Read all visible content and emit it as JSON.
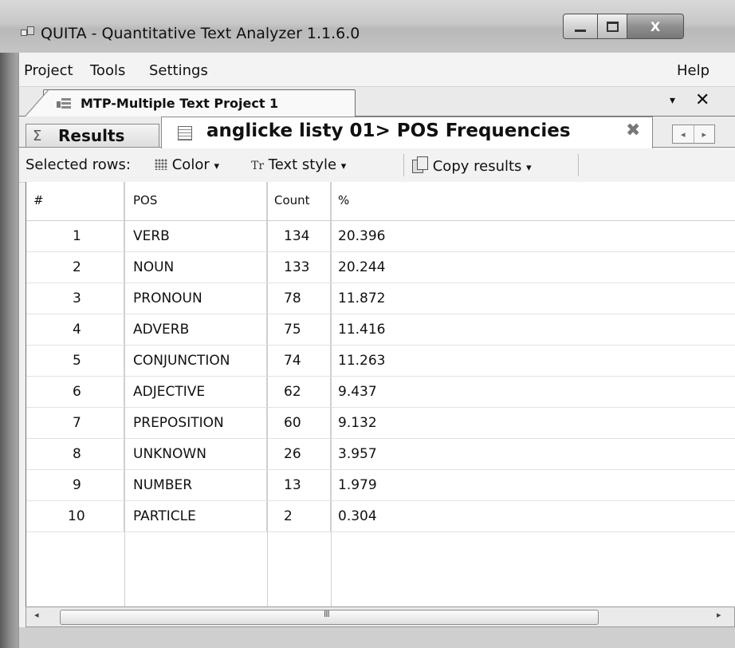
{
  "window": {
    "title": "QUITA - Quantitative Text Analyzer 1.1.6.0",
    "close_glyph": "X"
  },
  "menu": {
    "items": [
      "Project",
      "Tools",
      "Settings"
    ],
    "help": "Help"
  },
  "doc_tab": {
    "label": "MTP-Multiple Text Project 1",
    "dropdown": "▾",
    "close": "✕"
  },
  "result_tabs": {
    "results_label": "Results",
    "active_label": "anglicke listy 01> POS Frequencies",
    "close": "✖"
  },
  "toolbar": {
    "selected_rows": "Selected rows:",
    "color": "Color",
    "text_style": "Text style",
    "copy_results": "Copy results",
    "dropdown_arrow": "▾"
  },
  "table": {
    "columns": [
      "#",
      "POS",
      "Count",
      "%"
    ],
    "rows": [
      [
        "1",
        "VERB",
        "134",
        "20.396"
      ],
      [
        "2",
        "NOUN",
        "133",
        "20.244"
      ],
      [
        "3",
        "PRONOUN",
        "78",
        "11.872"
      ],
      [
        "4",
        "ADVERB",
        "75",
        "11.416"
      ],
      [
        "5",
        "CONJUNCTION",
        "74",
        "11.263"
      ],
      [
        "6",
        "ADJECTIVE",
        "62",
        "9.437"
      ],
      [
        "7",
        "PREPOSITION",
        "60",
        "9.132"
      ],
      [
        "8",
        "UNKNOWN",
        "26",
        "3.957"
      ],
      [
        "9",
        "NUMBER",
        "13",
        "1.979"
      ],
      [
        "10",
        "PARTICLE",
        "2",
        "0.304"
      ]
    ]
  },
  "scrollbar": {
    "left": "◂",
    "right": "▸",
    "grip": "III"
  }
}
